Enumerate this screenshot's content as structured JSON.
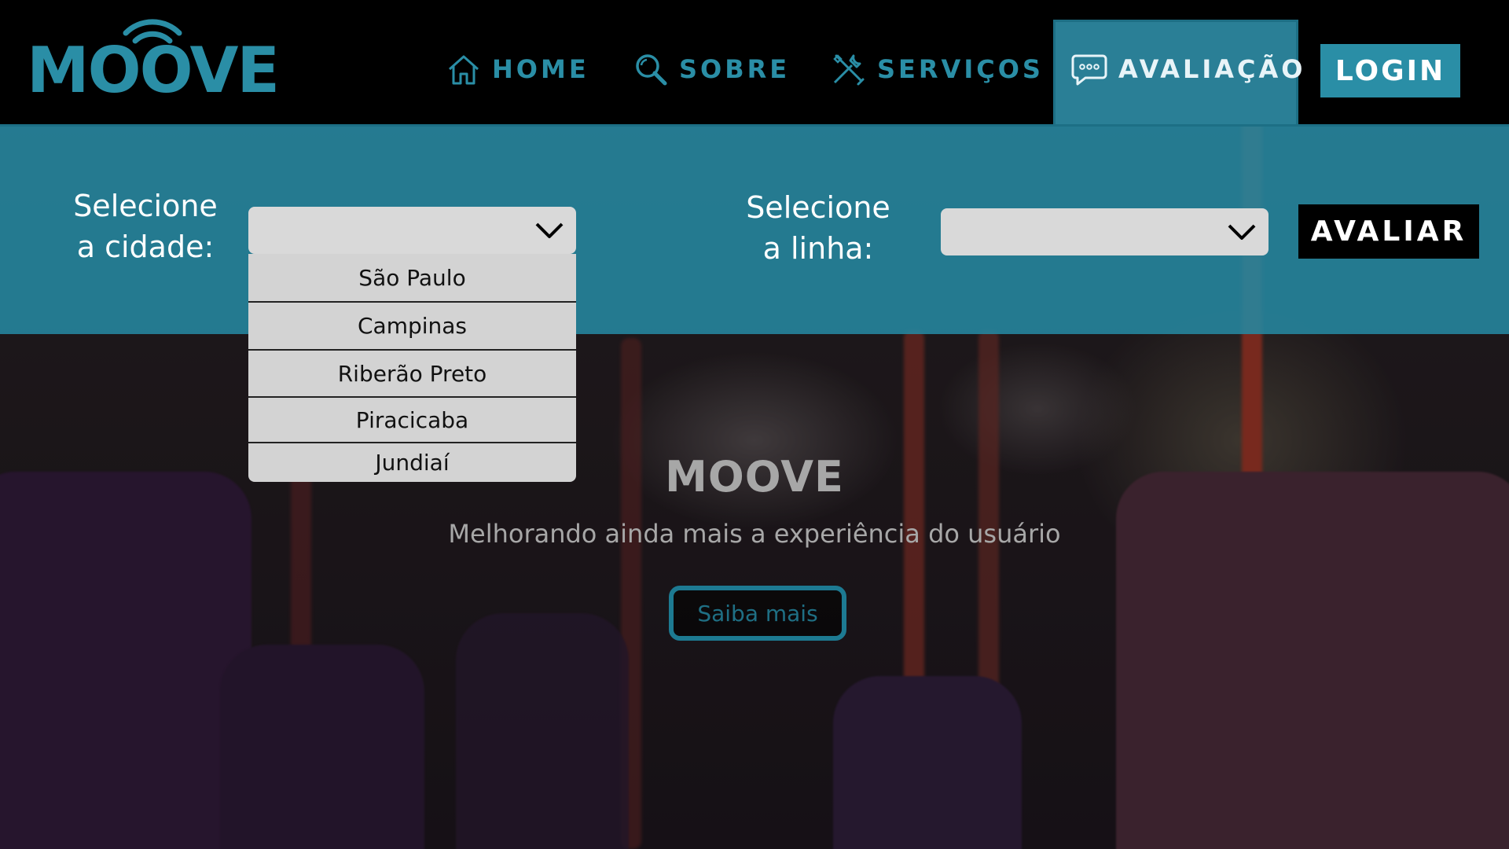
{
  "brand": {
    "name": "MOOVE",
    "accent": "#2a8ea6",
    "accent_dark": "#1d6f85",
    "active_tab_bg": "#2a7f96"
  },
  "nav": {
    "items": [
      {
        "label": "HOME",
        "icon": "home-icon"
      },
      {
        "label": "SOBRE",
        "icon": "search-icon"
      },
      {
        "label": "SERVIÇOS",
        "icon": "tools-icon"
      },
      {
        "label": "AVALIAÇÃO",
        "icon": "chat-icon",
        "active": true
      }
    ],
    "login_label": "LOGIN"
  },
  "filters": {
    "city_label_line1": "Selecione",
    "city_label_line2": "a cidade:",
    "city_value": "",
    "city_options": [
      "São Paulo",
      "Campinas",
      "Riberão Preto",
      "Piracicaba",
      "Jundiaí"
    ],
    "city_dropdown_open": true,
    "line_label_line1": "Selecione",
    "line_label_line2": "a linha:",
    "line_value": "",
    "submit_label": "AVALIAR"
  },
  "hero": {
    "title": "MOOVE",
    "subtitle": "Melhorando ainda mais a experiência do usuário",
    "cta_label": "Saiba mais"
  }
}
